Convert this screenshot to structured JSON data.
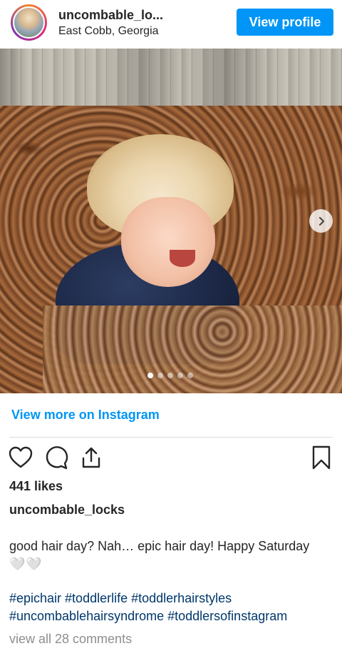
{
  "header": {
    "username": "uncombable_lo...",
    "location": "East Cobb, Georgia",
    "view_profile_label": "View profile"
  },
  "carousel": {
    "slide_count": 5,
    "active_index": 0
  },
  "view_more_label": "View more on Instagram",
  "likes": "441 likes",
  "owner": "uncombable_locks",
  "caption": "good hair day? Nah… epic hair day! Happy Saturday",
  "caption_emoji": "🤍🤍",
  "hashtags_line1": "#epichair #toddlerlife #toddlerhairstyles",
  "hashtags_line2": "#uncombablehairsyndrome #toddlersofinstagram",
  "comments_link": "view all 28 comments",
  "icons": [
    "heart-icon",
    "comment-icon",
    "share-icon",
    "bookmark-icon",
    "chevron-right-icon"
  ],
  "colors": {
    "accent": "#0095f6",
    "hashtag": "#00376b",
    "muted": "#8e8e8e"
  }
}
